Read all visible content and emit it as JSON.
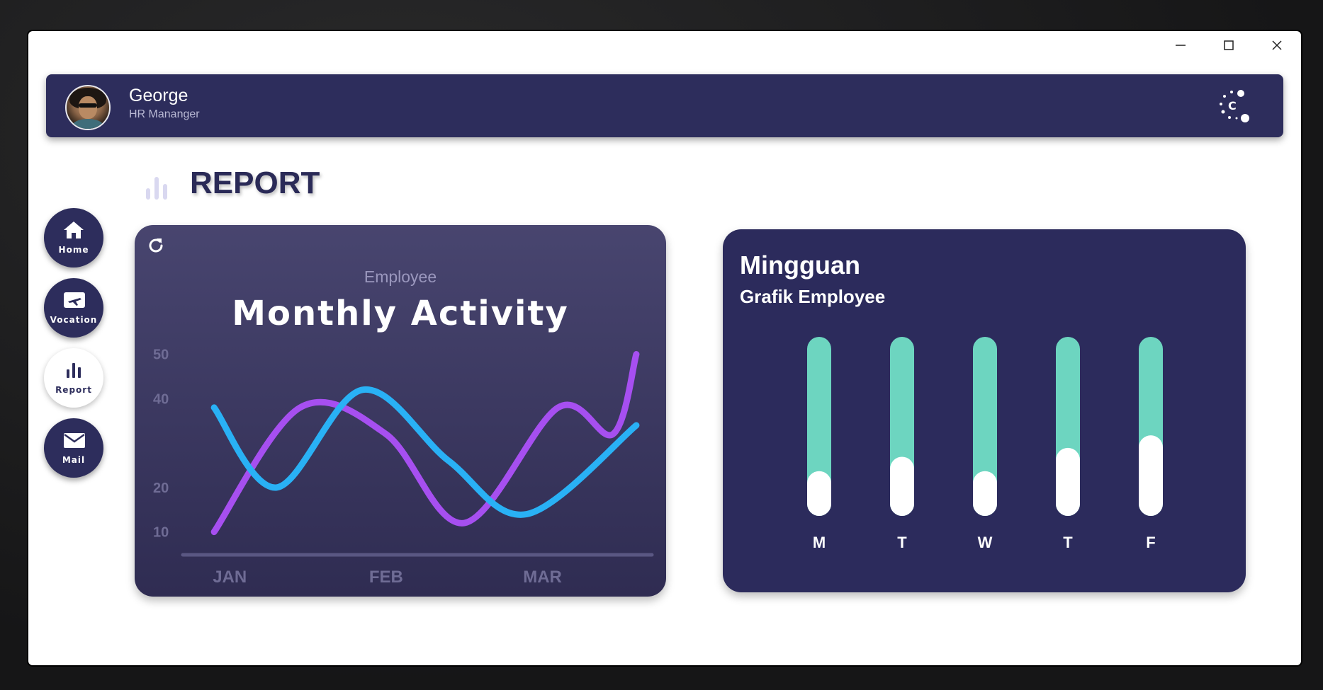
{
  "window": {
    "controls": [
      "minimize",
      "maximize",
      "close"
    ]
  },
  "header": {
    "user_name": "George",
    "user_role": "HR Mananger",
    "avatar": "user-avatar",
    "logo": "brand-logo-icon"
  },
  "page": {
    "title": "REPORT",
    "title_icon": "bar-chart-icon"
  },
  "nav": {
    "items": [
      {
        "label": "Home",
        "icon": "home-icon",
        "active": false
      },
      {
        "label": "Vocation",
        "icon": "flight-ticket-icon",
        "active": false
      },
      {
        "label": "Report",
        "icon": "bar-chart-icon",
        "active": true
      },
      {
        "label": "Mail",
        "icon": "mail-icon",
        "active": false
      }
    ]
  },
  "monthly_card": {
    "subtitle": "Employee",
    "title": "Monthly Activity",
    "refresh_icon": "refresh-icon"
  },
  "weekly_card": {
    "title": "Mingguan",
    "subtitle": "Grafik Employee"
  },
  "colors": {
    "navy": "#2d2d5c",
    "series_purple": "#a64ff0",
    "series_blue": "#29b1f5",
    "bar_track": "#6dd5c0",
    "bar_fill": "#ffffff"
  },
  "chart_data": [
    {
      "type": "line",
      "title": "Monthly Activity",
      "subtitle": "Employee",
      "categories": [
        "JAN",
        "FEB",
        "MAR"
      ],
      "y_ticks": [
        10,
        20,
        40,
        50
      ],
      "ylim": [
        5,
        52
      ],
      "x_range": [
        0.2,
        3.2
      ],
      "series": [
        {
          "color": "#a64ff0",
          "x": [
            0.4,
            0.95,
            1.5,
            2.0,
            2.6,
            2.95,
            3.1
          ],
          "y": [
            10,
            38,
            32,
            12,
            38,
            32,
            50
          ]
        },
        {
          "color": "#29b1f5",
          "x": [
            0.4,
            0.8,
            1.35,
            1.9,
            2.4,
            3.1
          ],
          "y": [
            38,
            20,
            42,
            26,
            14,
            34
          ]
        }
      ],
      "grid": false
    },
    {
      "type": "bar",
      "title": "Mingguan",
      "subtitle": "Grafik Employee",
      "categories": [
        "M",
        "T",
        "W",
        "T",
        "F"
      ],
      "values": [
        0.25,
        0.33,
        0.25,
        0.38,
        0.45
      ],
      "ylim": [
        0,
        1
      ]
    }
  ]
}
